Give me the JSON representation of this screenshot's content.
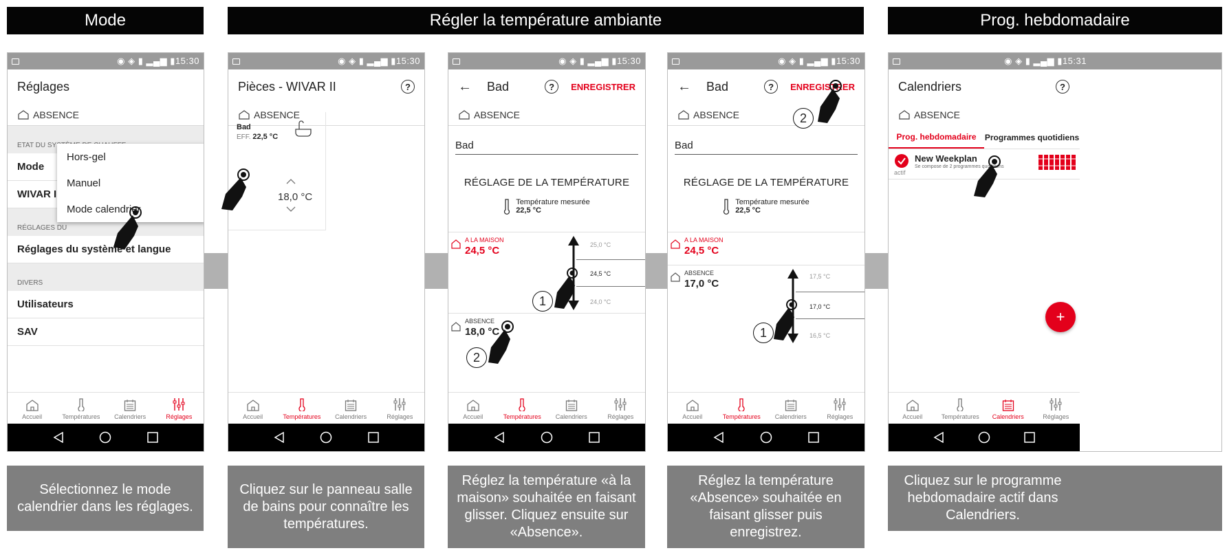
{
  "headers": {
    "mode": "Mode",
    "regler": "Régler la température ambiante",
    "prog": "Prog. hebdomadaire"
  },
  "captions": [
    "Sélectionnez le mode calendrier dans les réglages.",
    "Cliquez sur le panneau salle de bains pour connaître les températures.",
    "Réglez la température «à la maison» souhaitée en faisant glisser. Cliquez ensuite sur «Absence».",
    "Réglez la température «Absence» souhaitée en faisant glisser puis enregistrez.",
    "Cliquez sur le programme hebdomadaire actif dans Calendriers."
  ],
  "status_time": "15:30",
  "status_time_last": "15:31",
  "absence_label": "ABSENCE",
  "nav": {
    "accueil": "Accueil",
    "temperatures": "Températures",
    "calendriers": "Calendriers",
    "reglages": "Réglages"
  },
  "screen1": {
    "title": "Réglages",
    "section1": "ETAT DU SYSTÈME DE CHAUFFE",
    "row_mode": "Mode",
    "row_wivar": "WIVAR II p",
    "section2": "RÉGLAGES DU",
    "row_systeme": "Réglages du système et langue",
    "section3": "DIVERS",
    "row_utilisateurs": "Utilisateurs",
    "row_sav": "SAV",
    "dropdown": [
      "Hors-gel",
      "Manuel",
      "Mode calendrier"
    ]
  },
  "screen2": {
    "title": "Pièces - WIVAR II",
    "room_name": "Bad",
    "room_eff_label": "EFF.",
    "room_eff_value": "22,5 °C",
    "room_setpoint": "18,0 °C"
  },
  "screen3": {
    "title": "Bad",
    "save": "ENREGISTRER",
    "name_field": "Bad",
    "heading": "RÉGLAGE DE LA TEMPÉRATURE",
    "measured_label": "Température mesurée",
    "measured_value": "22,5 °C",
    "home_label": "A LA MAISON",
    "home_value": "24,5 °C",
    "scale": [
      "25,0 °C",
      "24,5 °C",
      "24,0 °C"
    ],
    "absence_label": "ABSENCE",
    "absence_value": "18,0 °C"
  },
  "screen4": {
    "title": "Bad",
    "save": "ENREGISTRER",
    "name_field": "Bad",
    "heading": "RÉGLAGE DE LA TEMPÉRATURE",
    "measured_label": "Température mesurée",
    "measured_value": "22,5 °C",
    "home_label": "A LA MAISON",
    "home_value": "24,5 °C",
    "absence_label": "ABSENCE",
    "absence_value": "17,0 °C",
    "scale": [
      "17,5 °C",
      "17,0 °C",
      "16,5 °C"
    ]
  },
  "screen5": {
    "title": "Calendriers",
    "tab_prog": "Prog. hebdomadaire",
    "tab_quot": "Programmes quotidiens",
    "plan_name": "New Weekplan",
    "plan_desc": "Se compose de 2 programmes quotidiens",
    "plan_status": "actif",
    "fab": "+"
  },
  "badges": {
    "one": "1",
    "two": "2"
  },
  "colors": {
    "accent": "#e3001b",
    "caption_bg": "#7f7f7f",
    "header_bg": "#050505",
    "connector": "#b1b1b1"
  }
}
